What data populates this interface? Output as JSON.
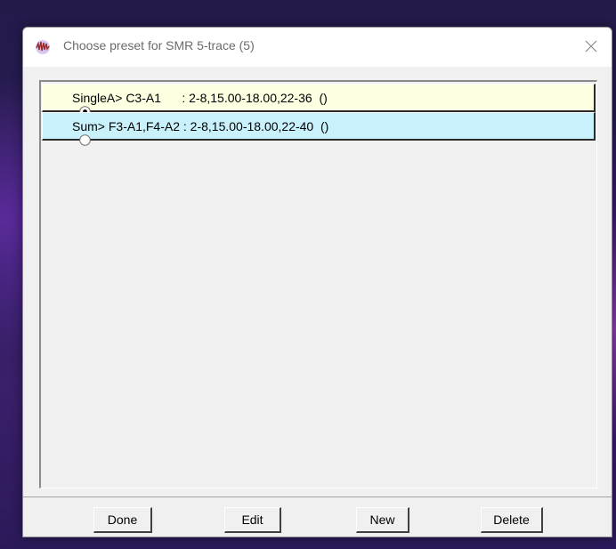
{
  "window": {
    "title": "Choose preset for SMR 5-trace (5)",
    "app_icon": "app-waveform-icon",
    "close_icon": "close-icon"
  },
  "presets": [
    {
      "label": "SingleA> C3-A1      : 2-8,15.00-18.00,22-36  ()",
      "selected": true,
      "bg_color": "#ffffe1"
    },
    {
      "label": "Sum> F3-A1,F4-A2 : 2-8,15.00-18.00,22-40  ()",
      "selected": false,
      "bg_color": "#c9f1fb"
    }
  ],
  "buttons": {
    "done": "Done",
    "edit": "Edit",
    "new": "New",
    "delete": "Delete"
  }
}
